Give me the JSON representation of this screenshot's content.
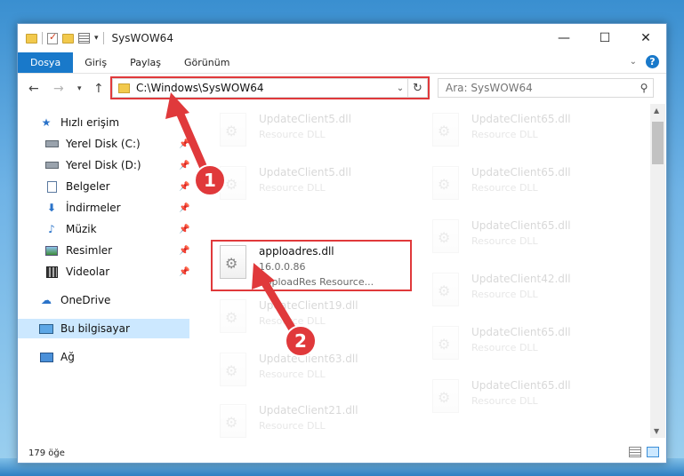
{
  "window": {
    "title": "SysWOW64",
    "controls": {
      "minimize": "—",
      "maximize": "☐",
      "close": "✕"
    }
  },
  "ribbon": {
    "tabs": [
      "Dosya",
      "Giriş",
      "Paylaş",
      "Görünüm"
    ]
  },
  "address": {
    "path": "C:\\Windows\\SysWOW64"
  },
  "search": {
    "placeholder": "Ara: SysWOW64"
  },
  "sidebar": {
    "quick_access": "Hızlı erişim",
    "items": [
      {
        "label": "Yerel Disk (C:)",
        "icon": "drive-icon",
        "pinned": true
      },
      {
        "label": "Yerel Disk (D:)",
        "icon": "drive-icon",
        "pinned": true
      },
      {
        "label": "Belgeler",
        "icon": "documents-icon",
        "pinned": true
      },
      {
        "label": "İndirmeler",
        "icon": "downloads-icon",
        "pinned": true
      },
      {
        "label": "Müzik",
        "icon": "music-icon",
        "pinned": true
      },
      {
        "label": "Resimler",
        "icon": "pictures-icon",
        "pinned": true
      },
      {
        "label": "Videolar",
        "icon": "videos-icon",
        "pinned": true
      }
    ],
    "onedrive": "OneDrive",
    "this_pc": "Bu bilgisayar",
    "network": "Ağ"
  },
  "files": {
    "left": [
      {
        "name": "UpdateClient5.dll",
        "desc": "Resource DLL"
      },
      {
        "name": "UpdateClient5.dll",
        "desc": "Resource DLL"
      },
      {
        "name": "UpdateClient19.dll",
        "desc": "Resource DLL"
      },
      {
        "name": "UpdateClient63.dll",
        "desc": "Resource DLL"
      },
      {
        "name": "UpdateClient21.dll",
        "desc": "Resource DLL"
      }
    ],
    "right": [
      {
        "name": "UpdateClient65.dll",
        "desc": "Resource DLL"
      },
      {
        "name": "UpdateClient65.dll",
        "desc": "Resource DLL"
      },
      {
        "name": "UpdateClient65.dll",
        "desc": "Resource DLL"
      },
      {
        "name": "UpdateClient42.dll",
        "desc": "Resource DLL"
      },
      {
        "name": "UpdateClient65.dll",
        "desc": "Resource DLL"
      },
      {
        "name": "UpdateClient65.dll",
        "desc": "Resource DLL"
      }
    ],
    "highlighted": {
      "name": "apploadres.dll",
      "version": "16.0.0.86",
      "desc": "ApploadRes Resource..."
    }
  },
  "status": {
    "count": "179 öğe"
  },
  "annotations": {
    "step1": "1",
    "step2": "2",
    "color": "#e0393b"
  }
}
